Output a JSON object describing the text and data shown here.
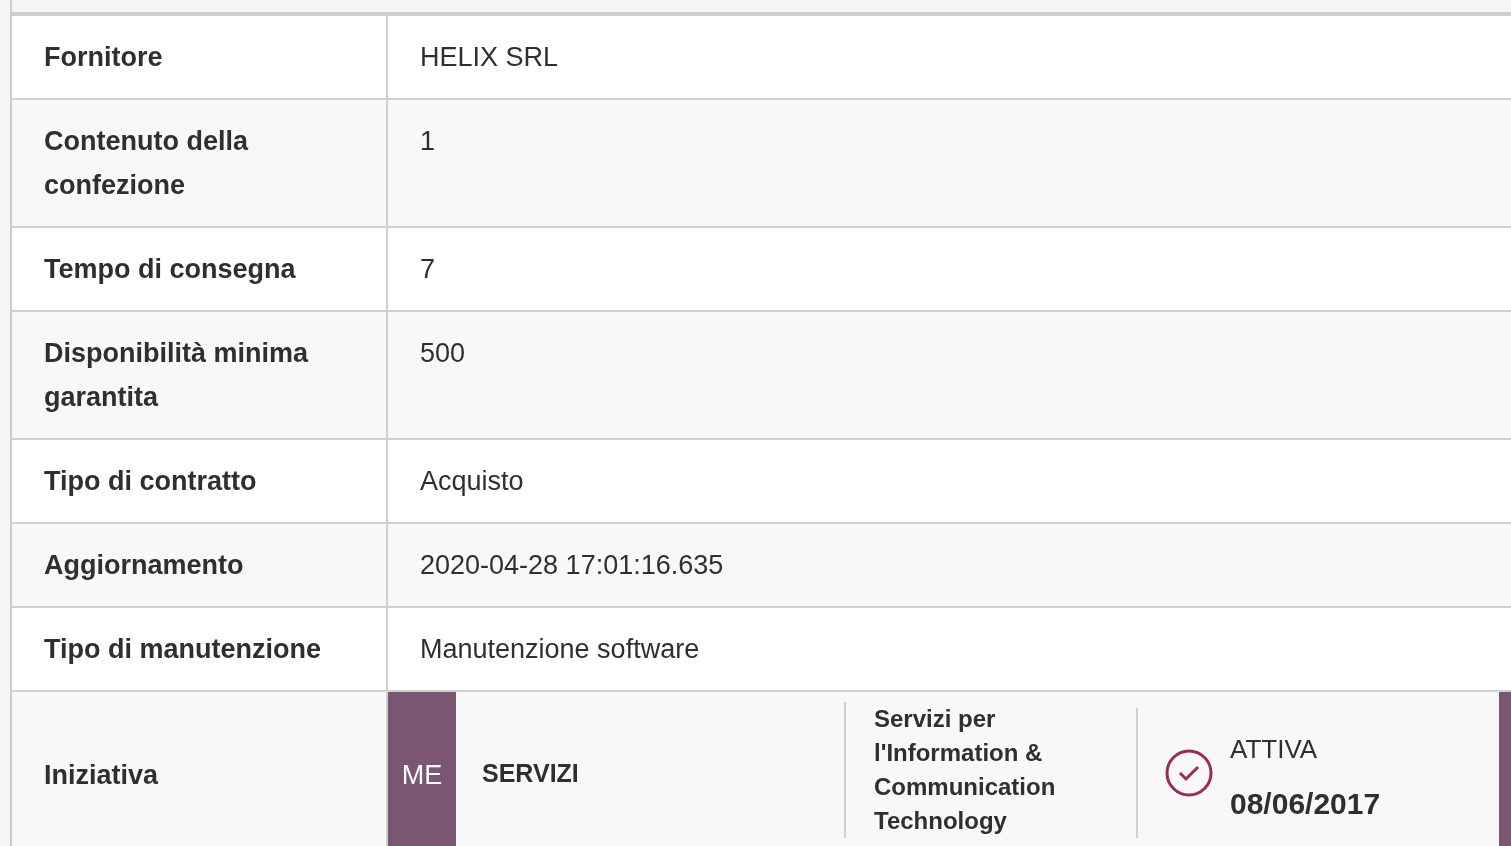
{
  "rows": [
    {
      "kind": "text",
      "label": "Fornitore",
      "value": "HELIX SRL"
    },
    {
      "kind": "text",
      "label": "Contenuto della confezione",
      "value": "1"
    },
    {
      "kind": "text",
      "label": "Tempo di consegna",
      "value": "7"
    },
    {
      "kind": "text",
      "label": "Disponibilità minima garantita",
      "value": "500"
    },
    {
      "kind": "text",
      "label": "Tipo di contratto",
      "value": "Acquisto"
    },
    {
      "kind": "text",
      "label": "Aggiornamento",
      "value": "2020-04-28 17:01:16.635"
    },
    {
      "kind": "text",
      "label": "Tipo di manutenzione",
      "value": "Manutenzione software"
    },
    {
      "kind": "initiative",
      "label": "Iniziativa",
      "code": "ME",
      "type": "SERVIZI",
      "category": "Servizi per l'Information & Communication Technology",
      "status": "ATTIVA",
      "date": "08/06/2017"
    }
  ]
}
